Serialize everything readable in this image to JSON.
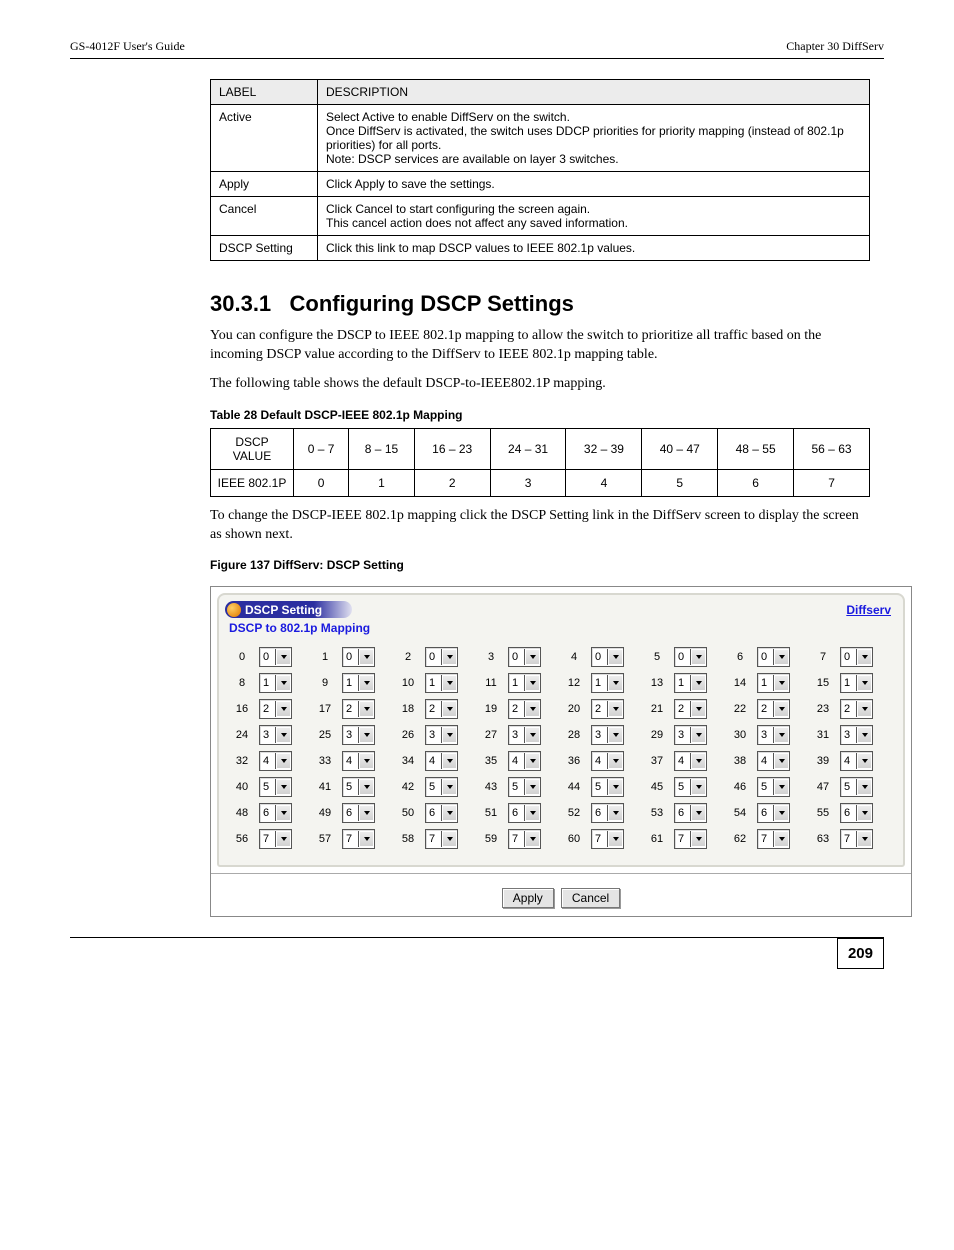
{
  "header": {
    "left": "GS-4012F User's Guide",
    "right": "Chapter 30 DiffServ"
  },
  "info_table": {
    "headers": [
      "LABEL",
      "DESCRIPTION"
    ],
    "rows": [
      {
        "label": "Active",
        "desc": "Select Active to enable DiffServ on the switch.\nOnce DiffServ is activated, the switch uses DDCP priorities for priority mapping (instead of 802.1p priorities) for all ports.\nNote: DSCP services are available on layer 3 switches."
      },
      {
        "label": "Apply",
        "desc": "Click Apply to save the settings."
      },
      {
        "label": "Cancel",
        "desc": "Click Cancel to start configuring the screen again.\nThis cancel action does not affect any saved information."
      },
      {
        "label": "DSCP Setting",
        "desc": "Click this link to map DSCP values to IEEE 802.1p values."
      }
    ]
  },
  "section2": {
    "number": "30.3.1",
    "title": "Configuring DSCP Settings",
    "para1": "You can configure the DSCP to IEEE 802.1p mapping to allow the switch to prioritize all traffic based on the incoming DSCP value according to the DiffServ to IEEE 802.1p mapping table.",
    "para2": "The following table shows the default DSCP-to-IEEE802.1P mapping."
  },
  "table28": {
    "caption": "Table 28   Default DSCP-IEEE 802.1p Mapping",
    "rows": [
      [
        "DSCP VALUE",
        "0 – 7",
        "8 – 15",
        "16 – 23",
        "24 – 31",
        "32 – 39",
        "40 – 47",
        "48 – 55",
        "56 – 63"
      ],
      [
        "IEEE 802.1P",
        "0",
        "1",
        "2",
        "3",
        "4",
        "5",
        "6",
        "7"
      ]
    ]
  },
  "para3": "To change the DSCP-IEEE 802.1p mapping click the DSCP Setting link in the DiffServ screen to display the screen as shown next.",
  "fig137": {
    "caption": "Figure 137   DiffServ: DSCP Setting"
  },
  "screenshot": {
    "titlebar": "DSCP Setting",
    "link": "Diffserv",
    "subtitle": "DSCP to 802.1p Mapping",
    "rows": [
      {
        "start": 0,
        "val": "0"
      },
      {
        "start": 8,
        "val": "1"
      },
      {
        "start": 16,
        "val": "2"
      },
      {
        "start": 24,
        "val": "3"
      },
      {
        "start": 32,
        "val": "4"
      },
      {
        "start": 40,
        "val": "5"
      },
      {
        "start": 48,
        "val": "6"
      },
      {
        "start": 56,
        "val": "7"
      }
    ],
    "apply": "Apply",
    "cancel": "Cancel"
  },
  "footer": {
    "left": "",
    "page": "209"
  }
}
